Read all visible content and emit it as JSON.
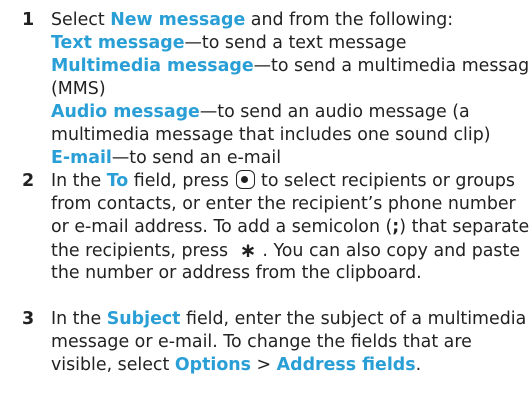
{
  "steps": [
    {
      "number": "1",
      "text": {
        "select": "Select ",
        "new_message": "New message",
        "following": " and from the following:",
        "text_message": "Text message",
        "text_message_desc": "—to send a text message",
        "multimedia_message": "Multimedia message",
        "multimedia_message_desc": "—to send a multimedia message",
        "mms": "(MMS)",
        "audio_message": "Audio message",
        "audio_message_desc": "—to send an audio message (a",
        "audio_line2": "multimedia message that includes one sound clip)",
        "email": "E-mail",
        "email_desc": "—to send an e-mail"
      }
    },
    {
      "number": "2",
      "text": {
        "in_the": "In the ",
        "to_field": "To",
        "field_press": " field, press ",
        "select_key_icon": "select-key-icon",
        "after_key": " to select recipients or groups",
        "line2": "from contacts, or enter the recipient’s phone number",
        "line3": "or e-mail address. To add a semicolon (",
        "semicolon": ";",
        "line3_end": ") that separates",
        "line4_start": "the recipients, press ",
        "star_key": "∗",
        "line4_end": ". You can also copy and paste",
        "line5": "the number or address from the clipboard."
      }
    },
    {
      "number": "3",
      "text": {
        "in_the": "In the ",
        "subject_field": "Subject",
        "line1_end": " field, enter the subject of a multimedia",
        "line2": "message or e-mail. To change the fields that are",
        "line3_start": "visible, select ",
        "options": "Options",
        "sep": " > ",
        "address_fields": "Address fields",
        "period": "."
      }
    }
  ],
  "colors": {
    "highlight": "#2a9fd6",
    "text": "#222222"
  }
}
